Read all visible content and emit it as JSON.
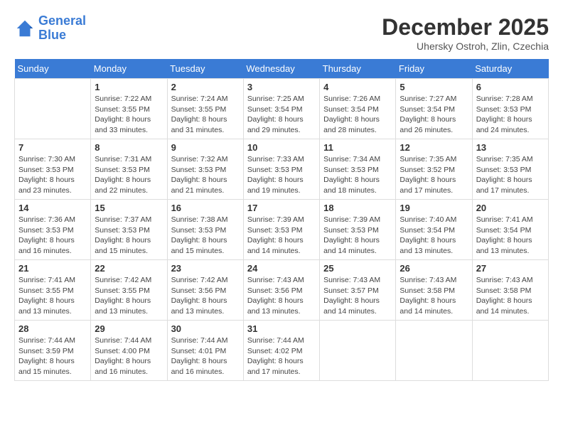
{
  "logo": {
    "line1": "General",
    "line2": "Blue"
  },
  "title": "December 2025",
  "location": "Uhersky Ostroh, Zlin, Czechia",
  "days_of_week": [
    "Sunday",
    "Monday",
    "Tuesday",
    "Wednesday",
    "Thursday",
    "Friday",
    "Saturday"
  ],
  "weeks": [
    [
      {
        "day": "",
        "info": ""
      },
      {
        "day": "1",
        "info": "Sunrise: 7:22 AM\nSunset: 3:55 PM\nDaylight: 8 hours\nand 33 minutes."
      },
      {
        "day": "2",
        "info": "Sunrise: 7:24 AM\nSunset: 3:55 PM\nDaylight: 8 hours\nand 31 minutes."
      },
      {
        "day": "3",
        "info": "Sunrise: 7:25 AM\nSunset: 3:54 PM\nDaylight: 8 hours\nand 29 minutes."
      },
      {
        "day": "4",
        "info": "Sunrise: 7:26 AM\nSunset: 3:54 PM\nDaylight: 8 hours\nand 28 minutes."
      },
      {
        "day": "5",
        "info": "Sunrise: 7:27 AM\nSunset: 3:54 PM\nDaylight: 8 hours\nand 26 minutes."
      },
      {
        "day": "6",
        "info": "Sunrise: 7:28 AM\nSunset: 3:53 PM\nDaylight: 8 hours\nand 24 minutes."
      }
    ],
    [
      {
        "day": "7",
        "info": "Sunrise: 7:30 AM\nSunset: 3:53 PM\nDaylight: 8 hours\nand 23 minutes."
      },
      {
        "day": "8",
        "info": "Sunrise: 7:31 AM\nSunset: 3:53 PM\nDaylight: 8 hours\nand 22 minutes."
      },
      {
        "day": "9",
        "info": "Sunrise: 7:32 AM\nSunset: 3:53 PM\nDaylight: 8 hours\nand 21 minutes."
      },
      {
        "day": "10",
        "info": "Sunrise: 7:33 AM\nSunset: 3:53 PM\nDaylight: 8 hours\nand 19 minutes."
      },
      {
        "day": "11",
        "info": "Sunrise: 7:34 AM\nSunset: 3:53 PM\nDaylight: 8 hours\nand 18 minutes."
      },
      {
        "day": "12",
        "info": "Sunrise: 7:35 AM\nSunset: 3:52 PM\nDaylight: 8 hours\nand 17 minutes."
      },
      {
        "day": "13",
        "info": "Sunrise: 7:35 AM\nSunset: 3:53 PM\nDaylight: 8 hours\nand 17 minutes."
      }
    ],
    [
      {
        "day": "14",
        "info": "Sunrise: 7:36 AM\nSunset: 3:53 PM\nDaylight: 8 hours\nand 16 minutes."
      },
      {
        "day": "15",
        "info": "Sunrise: 7:37 AM\nSunset: 3:53 PM\nDaylight: 8 hours\nand 15 minutes."
      },
      {
        "day": "16",
        "info": "Sunrise: 7:38 AM\nSunset: 3:53 PM\nDaylight: 8 hours\nand 15 minutes."
      },
      {
        "day": "17",
        "info": "Sunrise: 7:39 AM\nSunset: 3:53 PM\nDaylight: 8 hours\nand 14 minutes."
      },
      {
        "day": "18",
        "info": "Sunrise: 7:39 AM\nSunset: 3:53 PM\nDaylight: 8 hours\nand 14 minutes."
      },
      {
        "day": "19",
        "info": "Sunrise: 7:40 AM\nSunset: 3:54 PM\nDaylight: 8 hours\nand 13 minutes."
      },
      {
        "day": "20",
        "info": "Sunrise: 7:41 AM\nSunset: 3:54 PM\nDaylight: 8 hours\nand 13 minutes."
      }
    ],
    [
      {
        "day": "21",
        "info": "Sunrise: 7:41 AM\nSunset: 3:55 PM\nDaylight: 8 hours\nand 13 minutes."
      },
      {
        "day": "22",
        "info": "Sunrise: 7:42 AM\nSunset: 3:55 PM\nDaylight: 8 hours\nand 13 minutes."
      },
      {
        "day": "23",
        "info": "Sunrise: 7:42 AM\nSunset: 3:56 PM\nDaylight: 8 hours\nand 13 minutes."
      },
      {
        "day": "24",
        "info": "Sunrise: 7:43 AM\nSunset: 3:56 PM\nDaylight: 8 hours\nand 13 minutes."
      },
      {
        "day": "25",
        "info": "Sunrise: 7:43 AM\nSunset: 3:57 PM\nDaylight: 8 hours\nand 14 minutes."
      },
      {
        "day": "26",
        "info": "Sunrise: 7:43 AM\nSunset: 3:58 PM\nDaylight: 8 hours\nand 14 minutes."
      },
      {
        "day": "27",
        "info": "Sunrise: 7:43 AM\nSunset: 3:58 PM\nDaylight: 8 hours\nand 14 minutes."
      }
    ],
    [
      {
        "day": "28",
        "info": "Sunrise: 7:44 AM\nSunset: 3:59 PM\nDaylight: 8 hours\nand 15 minutes."
      },
      {
        "day": "29",
        "info": "Sunrise: 7:44 AM\nSunset: 4:00 PM\nDaylight: 8 hours\nand 16 minutes."
      },
      {
        "day": "30",
        "info": "Sunrise: 7:44 AM\nSunset: 4:01 PM\nDaylight: 8 hours\nand 16 minutes."
      },
      {
        "day": "31",
        "info": "Sunrise: 7:44 AM\nSunset: 4:02 PM\nDaylight: 8 hours\nand 17 minutes."
      },
      {
        "day": "",
        "info": ""
      },
      {
        "day": "",
        "info": ""
      },
      {
        "day": "",
        "info": ""
      }
    ]
  ]
}
